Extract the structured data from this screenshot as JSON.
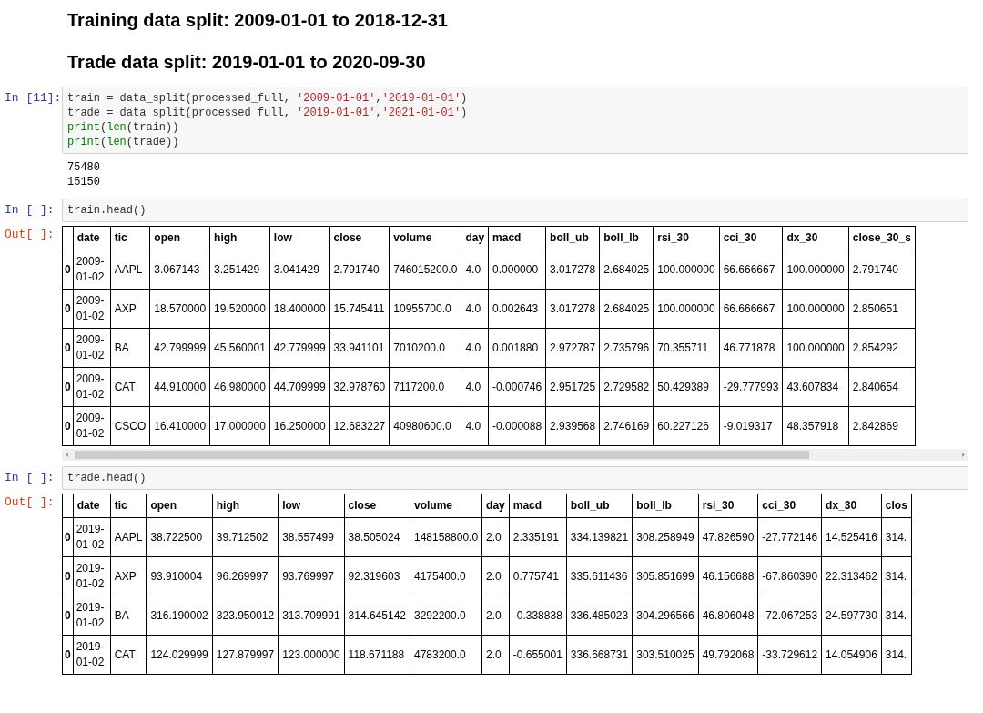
{
  "headings": [
    "Training data split: 2009-01-01 to 2018-12-31",
    "Trade data split: 2019-01-01 to 2020-09-30"
  ],
  "cells": [
    {
      "prompt": "In [11]:",
      "code": [
        [
          {
            "t": "train = data_split(processed_full, ",
            "kind": "plain"
          },
          {
            "t": "'2009-01-01'",
            "kind": "string"
          },
          {
            "t": ",",
            "kind": "plain"
          },
          {
            "t": "'2019-01-01'",
            "kind": "string"
          },
          {
            "t": ")",
            "kind": "plain"
          }
        ],
        [
          {
            "t": "trade = data_split(processed_full, ",
            "kind": "plain"
          },
          {
            "t": "'2019-01-01'",
            "kind": "string"
          },
          {
            "t": ",",
            "kind": "plain"
          },
          {
            "t": "'2021-01-01'",
            "kind": "string"
          },
          {
            "t": ")",
            "kind": "plain"
          }
        ],
        [
          {
            "t": "print",
            "kind": "builtin"
          },
          {
            "t": "(",
            "kind": "plain"
          },
          {
            "t": "len",
            "kind": "builtin"
          },
          {
            "t": "(train))",
            "kind": "plain"
          }
        ],
        [
          {
            "t": "print",
            "kind": "builtin"
          },
          {
            "t": "(",
            "kind": "plain"
          },
          {
            "t": "len",
            "kind": "builtin"
          },
          {
            "t": "(trade))",
            "kind": "plain"
          }
        ]
      ],
      "stdout": [
        "75480",
        "15150"
      ]
    },
    {
      "prompt": "In [ ]:",
      "code": [
        [
          {
            "t": "train.head()",
            "kind": "plain"
          }
        ]
      ],
      "out_prompt": "Out[ ]:",
      "scrollbar": true,
      "table": {
        "columns": [
          "date",
          "tic",
          "open",
          "high",
          "low",
          "close",
          "volume",
          "day",
          "macd",
          "boll_ub",
          "boll_lb",
          "rsi_30",
          "cci_30",
          "dx_30",
          "close_30_s"
        ],
        "rows": [
          {
            "index": "0",
            "cells": [
              "2009-01-02",
              "AAPL",
              "3.067143",
              "3.251429",
              "3.041429",
              "2.791740",
              "746015200.0",
              "4.0",
              "0.000000",
              "3.017278",
              "2.684025",
              "100.000000",
              "66.666667",
              "100.000000",
              "2.791740"
            ]
          },
          {
            "index": "0",
            "cells": [
              "2009-01-02",
              "AXP",
              "18.570000",
              "19.520000",
              "18.400000",
              "15.745411",
              "10955700.0",
              "4.0",
              "0.002643",
              "3.017278",
              "2.684025",
              "100.000000",
              "66.666667",
              "100.000000",
              "2.850651"
            ]
          },
          {
            "index": "0",
            "cells": [
              "2009-01-02",
              "BA",
              "42.799999",
              "45.560001",
              "42.779999",
              "33.941101",
              "7010200.0",
              "4.0",
              "0.001880",
              "2.972787",
              "2.735796",
              "70.355711",
              "46.771878",
              "100.000000",
              "2.854292"
            ]
          },
          {
            "index": "0",
            "cells": [
              "2009-01-02",
              "CAT",
              "44.910000",
              "46.980000",
              "44.709999",
              "32.978760",
              "7117200.0",
              "4.0",
              "-0.000746",
              "2.951725",
              "2.729582",
              "50.429389",
              "-29.777993",
              "43.607834",
              "2.840654"
            ]
          },
          {
            "index": "0",
            "cells": [
              "2009-01-02",
              "CSCO",
              "16.410000",
              "17.000000",
              "16.250000",
              "12.683227",
              "40980600.0",
              "4.0",
              "-0.000088",
              "2.939568",
              "2.746169",
              "60.227126",
              "-9.019317",
              "48.357918",
              "2.842869"
            ]
          }
        ]
      }
    },
    {
      "prompt": "In [ ]:",
      "code": [
        [
          {
            "t": "trade.head()",
            "kind": "plain"
          }
        ]
      ],
      "out_prompt": "Out[ ]:",
      "scrollbar": false,
      "table": {
        "columns": [
          "date",
          "tic",
          "open",
          "high",
          "low",
          "close",
          "volume",
          "day",
          "macd",
          "boll_ub",
          "boll_lb",
          "rsi_30",
          "cci_30",
          "dx_30",
          "clos"
        ],
        "rows": [
          {
            "index": "0",
            "cells": [
              "2019-01-02",
              "AAPL",
              "38.722500",
              "39.712502",
              "38.557499",
              "38.505024",
              "148158800.0",
              "2.0",
              "2.335191",
              "334.139821",
              "308.258949",
              "47.826590",
              "-27.772146",
              "14.525416",
              "314."
            ]
          },
          {
            "index": "0",
            "cells": [
              "2019-01-02",
              "AXP",
              "93.910004",
              "96.269997",
              "93.769997",
              "92.319603",
              "4175400.0",
              "2.0",
              "0.775741",
              "335.611436",
              "305.851699",
              "46.156688",
              "-67.860390",
              "22.313462",
              "314."
            ]
          },
          {
            "index": "0",
            "cells": [
              "2019-01-02",
              "BA",
              "316.190002",
              "323.950012",
              "313.709991",
              "314.645142",
              "3292200.0",
              "2.0",
              "-0.338838",
              "336.485023",
              "304.296566",
              "46.806048",
              "-72.067253",
              "24.597730",
              "314."
            ]
          },
          {
            "index": "0",
            "cells": [
              "2019-01-02",
              "CAT",
              "124.029999",
              "127.879997",
              "123.000000",
              "118.671188",
              "4783200.0",
              "2.0",
              "-0.655001",
              "336.668731",
              "303.510025",
              "49.792068",
              "-33.729612",
              "14.054906",
              "314."
            ]
          }
        ]
      }
    }
  ]
}
